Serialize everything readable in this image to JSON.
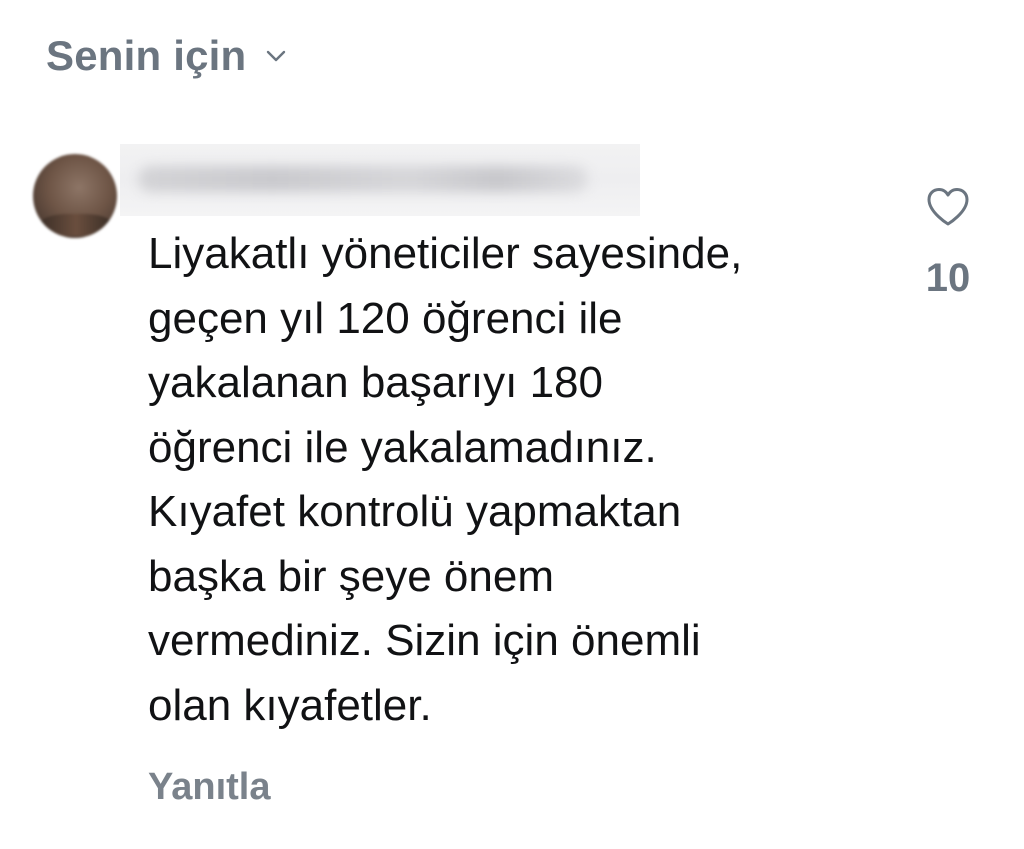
{
  "sort": {
    "label": "Senin için",
    "icon": "chevron-down-icon"
  },
  "comment": {
    "lines": [
      "Liyakatlı yöneticiler sayesinde,",
      "geçen yıl 120 öğrenci ile",
      "yakalanan başarıyı 180",
      "öğrenci ile yakalamadınız.",
      "Kıyafet kontrolü yapmaktan",
      "başka bir şeye önem",
      "vermediniz. Sizin için önemli",
      "olan kıyafetler."
    ],
    "reply_label": "Yanıtla",
    "like_count": "10",
    "like_icon": "heart-outline-icon"
  },
  "colors": {
    "secondary_text": "#6b7580",
    "body_text": "#111214",
    "background": "#ffffff"
  }
}
